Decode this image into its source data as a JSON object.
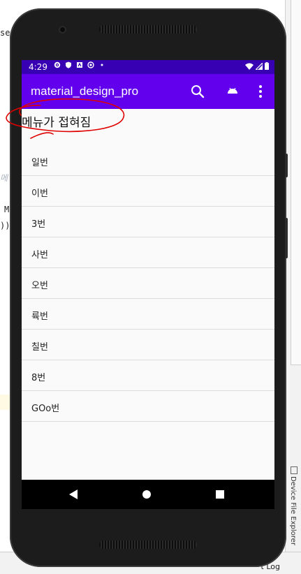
{
  "ide": {
    "code_fragments": [
      "se",
      "M",
      "));",
      "메"
    ],
    "bottom_tab_label": "t Log",
    "side_tab_label": "Device File Explorer"
  },
  "status_bar": {
    "time": "4:29",
    "icons_left": [
      "gear-icon",
      "shield-icon",
      "app-icon",
      "block-icon",
      "dot-icon"
    ],
    "icons_right": [
      "wifi-icon",
      "signal-icon",
      "battery-icon"
    ]
  },
  "app_bar": {
    "title": "material_design_pro",
    "actions": [
      "search-icon",
      "android-icon",
      "more-vert-icon"
    ]
  },
  "annotation": {
    "text": "메뉴가 접혀짐",
    "color": "#e00000"
  },
  "list": {
    "items": [
      {
        "label": "일번"
      },
      {
        "label": "이번"
      },
      {
        "label": "3번"
      },
      {
        "label": "사번"
      },
      {
        "label": "오번"
      },
      {
        "label": "륙번"
      },
      {
        "label": "칠번"
      },
      {
        "label": "8번"
      },
      {
        "label": "GOo번"
      }
    ]
  },
  "nav_bar": {
    "buttons": [
      "back-icon",
      "home-icon",
      "recents-icon"
    ]
  },
  "colors": {
    "status_bar": "#3700b3",
    "app_bar": "#6200ee",
    "screen_bg": "#fafafa",
    "divider": "#dcdcdc",
    "annotation": "#e00000"
  }
}
